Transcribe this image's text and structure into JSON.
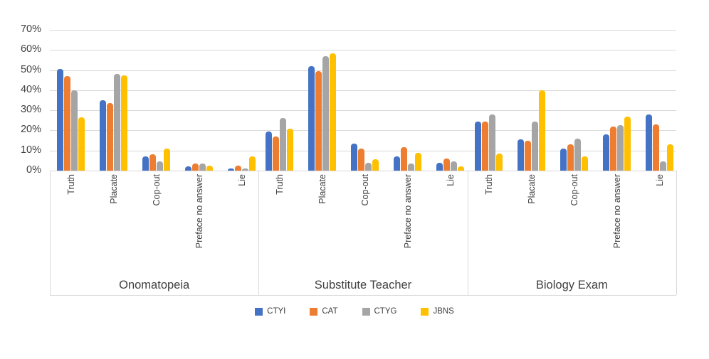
{
  "chart_data": {
    "type": "bar",
    "title": "",
    "xlabel": "",
    "ylabel": "",
    "ylim": [
      0,
      70
    ],
    "ytick_labels": [
      "0%",
      "10%",
      "20%",
      "30%",
      "40%",
      "50%",
      "60%",
      "70%"
    ],
    "ytick_values": [
      0,
      10,
      20,
      30,
      40,
      50,
      60,
      70
    ],
    "grid": true,
    "legend_position": "bottom",
    "categories": [
      "Truth",
      "Placate",
      "Cop-out",
      "Preface no answer",
      "Lie"
    ],
    "groups": [
      "Onomatopeia",
      "Substitute Teacher",
      "Biology Exam"
    ],
    "series": [
      {
        "name": "CTYI",
        "color": "#4472C4",
        "values_by_group": {
          "Onomatopeia": [
            50.5,
            35,
            7,
            2,
            1
          ],
          "Substitute Teacher": [
            19.5,
            52,
            13.5,
            7,
            4
          ],
          "Biology Exam": [
            24.5,
            15.5,
            11,
            18,
            28
          ]
        }
      },
      {
        "name": "CAT",
        "color": "#ED7D31",
        "values_by_group": {
          "Onomatopeia": [
            47,
            33.5,
            8,
            3.5,
            2.5
          ],
          "Substitute Teacher": [
            17,
            49.5,
            11,
            11.5,
            6
          ],
          "Biology Exam": [
            24.5,
            15,
            13,
            22,
            23
          ]
        }
      },
      {
        "name": "CTYG",
        "color": "#A5A5A5",
        "values_by_group": {
          "Onomatopeia": [
            40,
            48,
            4.5,
            3.5,
            1
          ],
          "Substitute Teacher": [
            26,
            57,
            4,
            3.5,
            4.5
          ],
          "Biology Exam": [
            28,
            24.5,
            16,
            22.5,
            4.5
          ]
        }
      },
      {
        "name": "JBNS",
        "color": "#FFC000",
        "values_by_group": {
          "Onomatopeia": [
            26.5,
            47.5,
            11,
            2.5,
            7
          ],
          "Substitute Teacher": [
            21,
            58.5,
            5.5,
            9,
            2
          ],
          "Biology Exam": [
            8.5,
            40,
            7,
            27,
            13
          ]
        }
      }
    ]
  },
  "legend": {
    "items": [
      {
        "label": "CTYI",
        "color": "#4472C4"
      },
      {
        "label": "CAT",
        "color": "#ED7D31"
      },
      {
        "label": "CTYG",
        "color": "#A5A5A5"
      },
      {
        "label": "JBNS",
        "color": "#FFC000"
      }
    ]
  }
}
